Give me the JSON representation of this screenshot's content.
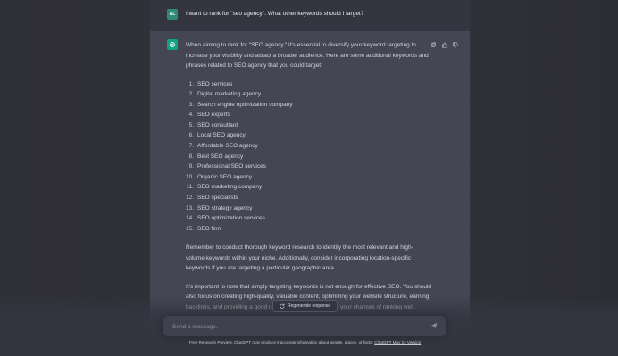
{
  "conversation": {
    "user": {
      "avatar_initials": "AL",
      "message": "I want to rank for \"seo agency\". What other keywords should I target?"
    },
    "assistant": {
      "intro": "When aiming to rank for \"SEO agency,\" it's essential to diversify your keyword targeting to increase your visibility and attract a broader audience. Here are some additional keywords and phrases related to SEO agency that you could target:",
      "keywords": [
        {
          "num": "1.",
          "text": "SEO services"
        },
        {
          "num": "2.",
          "text": "Digital marketing agency"
        },
        {
          "num": "3.",
          "text": "Search engine optimization company"
        },
        {
          "num": "4.",
          "text": "SEO experts"
        },
        {
          "num": "5.",
          "text": "SEO consultant"
        },
        {
          "num": "6.",
          "text": "Local SEO agency"
        },
        {
          "num": "7.",
          "text": "Affordable SEO agency"
        },
        {
          "num": "8.",
          "text": "Best SEO agency"
        },
        {
          "num": "9.",
          "text": "Professional SEO services"
        },
        {
          "num": "10.",
          "text": "Organic SEO agency"
        },
        {
          "num": "11.",
          "text": "SEO marketing company"
        },
        {
          "num": "12.",
          "text": "SEO specialists"
        },
        {
          "num": "13.",
          "text": "SEO strategy agency"
        },
        {
          "num": "14.",
          "text": "SEO optimization services"
        },
        {
          "num": "15.",
          "text": "SEO firm"
        }
      ],
      "reminder": "Remember to conduct thorough keyword research to identify the most relevant and high-volume keywords within your niche. Additionally, consider incorporating location-specific keywords if you are targeting a particular geographic area.",
      "note": "It's important to note that simply targeting keywords is not enough for effective SEO. You should also focus on creating high-quality, valuable content, optimizing your website structure, earning backlinks, and providing a good user experience to improve your chances of ranking well."
    }
  },
  "actions": {
    "copy_icon": "copy-icon",
    "thumbs_up_icon": "thumbs-up-icon",
    "thumbs_down_icon": "thumbs-down-icon",
    "regenerate_label": "Regenerate response"
  },
  "composer": {
    "placeholder": "Send a message."
  },
  "footer": {
    "text": "Free Research Preview. ChatGPT may produce inaccurate information about people, places, or facts. ",
    "link": "ChatGPT May 24 Version"
  },
  "colors": {
    "assistant_bg": "#444654",
    "user_bg": "#343541",
    "accent": "#10a37f"
  }
}
